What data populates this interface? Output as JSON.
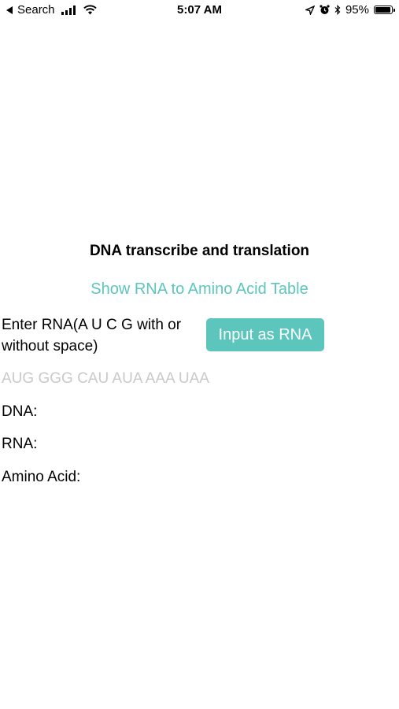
{
  "status_bar": {
    "back_label": "Search",
    "time": "5:07 AM",
    "battery": "95%",
    "battery_level": 0.95
  },
  "main": {
    "title": "DNA transcribe and translation",
    "table_link": "Show RNA to Amino Acid Table",
    "enter_label": "Enter RNA(A U C G with or without space)",
    "input_button": "Input as RNA",
    "input_value": "",
    "input_placeholder": "AUG GGG CAU AUA AAA UAA",
    "dna_label": "DNA:",
    "rna_label": "RNA:",
    "amino_label": "Amino Acid:"
  }
}
